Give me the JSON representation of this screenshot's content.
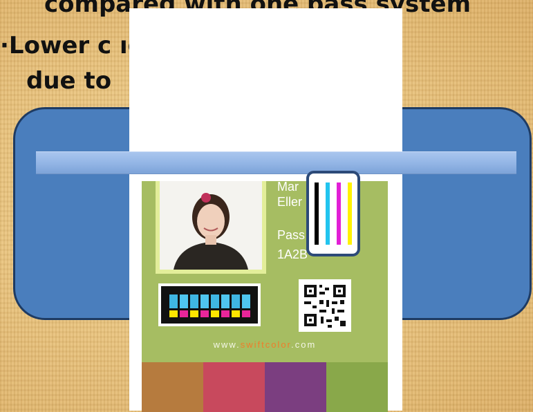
{
  "slide": {
    "text_lines": [
      "compared with one pass system",
      "·Lower c                        ıd printer",
      "due to"
    ]
  },
  "card": {
    "name_line1": "Mar",
    "name_line2": "Eller",
    "pass_label": "Pass",
    "pass_number": "1A2B",
    "url_prefix": "www.",
    "url_brand": "swiftcolor",
    "url_suffix": ".com"
  },
  "colors": {
    "box_fill": "#4a7ebd",
    "card_green": "#a6bd62",
    "cmyk": [
      "#000000",
      "#22c4ef",
      "#e21fd6",
      "#fff200"
    ],
    "bottom_strip": [
      "#b67b3e",
      "#c8495d",
      "#7b3e80",
      "#89a84a"
    ],
    "brand_accent": "#f07c2a"
  },
  "icons": {
    "cmyk_lines": "cmyk-lines-icon",
    "qr": "qr-code-icon",
    "color_bar": "color-swatch-bar-icon"
  }
}
